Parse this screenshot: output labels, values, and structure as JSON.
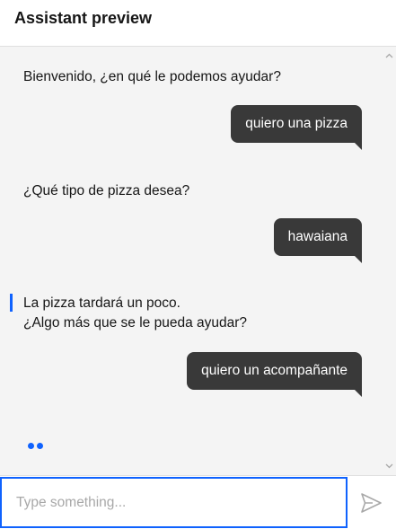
{
  "header": {
    "title": "Assistant preview"
  },
  "conversation": {
    "bot_1": {
      "text": "Bienvenido, ¿en qué le podemos ayudar?"
    },
    "user_1": {
      "text": "quiero una pizza"
    },
    "bot_2": {
      "text": "¿Qué tipo de pizza desea?"
    },
    "user_2": {
      "text": "hawaiana"
    },
    "bot_3": {
      "line1": "La pizza tardará un poco.",
      "line2": "¿Algo más que se le pueda ayudar?"
    },
    "user_3": {
      "text": "quiero un acompañante"
    }
  },
  "composer": {
    "placeholder": "Type something...",
    "value": ""
  },
  "icons": {
    "send": "send-icon",
    "scroll_up": "chevron-up-icon",
    "scroll_down": "chevron-down-icon"
  },
  "colors": {
    "accent": "#0f62fe",
    "user_bubble": "#393939",
    "chat_background": "#f4f4f4"
  }
}
